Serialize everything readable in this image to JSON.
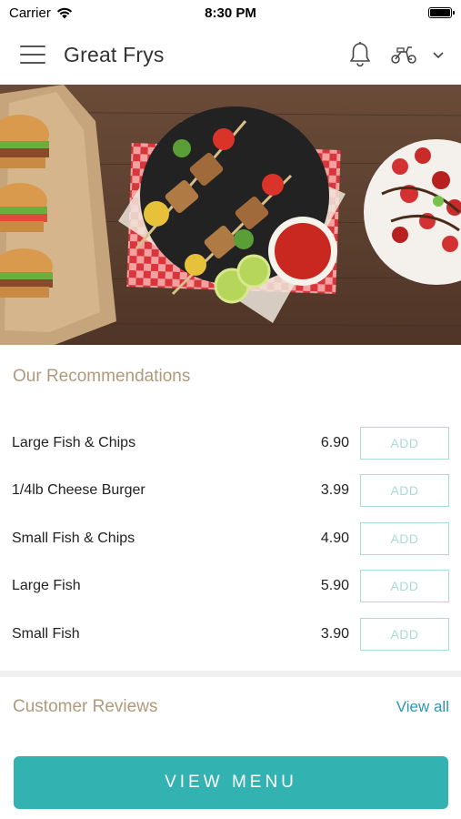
{
  "status_bar": {
    "carrier": "Carrier",
    "time": "8:30 PM"
  },
  "header": {
    "title": "Great Frys",
    "menu_icon": "hamburger-menu-icon",
    "bell_icon": "bell-icon",
    "scooter_icon": "scooter-icon",
    "chevron_icon": "chevron-down-icon"
  },
  "recommendations": {
    "title": "Our Recommendations",
    "items": [
      {
        "name": "Large Fish & Chips",
        "price": "6.90",
        "button": "ADD"
      },
      {
        "name": "1/4lb Cheese Burger",
        "price": "3.99",
        "button": "ADD"
      },
      {
        "name": "Small Fish & Chips",
        "price": "4.90",
        "button": "ADD"
      },
      {
        "name": "Large Fish",
        "price": "5.90",
        "button": "ADD"
      },
      {
        "name": "Small Fish",
        "price": "3.90",
        "button": "ADD"
      }
    ]
  },
  "reviews": {
    "title": "Customer Reviews",
    "view_all": "View all"
  },
  "footer": {
    "view_menu": "VIEW MENU"
  },
  "colors": {
    "accent": "#33b2b2",
    "section_title": "#b09a7c",
    "link": "#2a96b8",
    "add_button": "#a9dcd2"
  }
}
